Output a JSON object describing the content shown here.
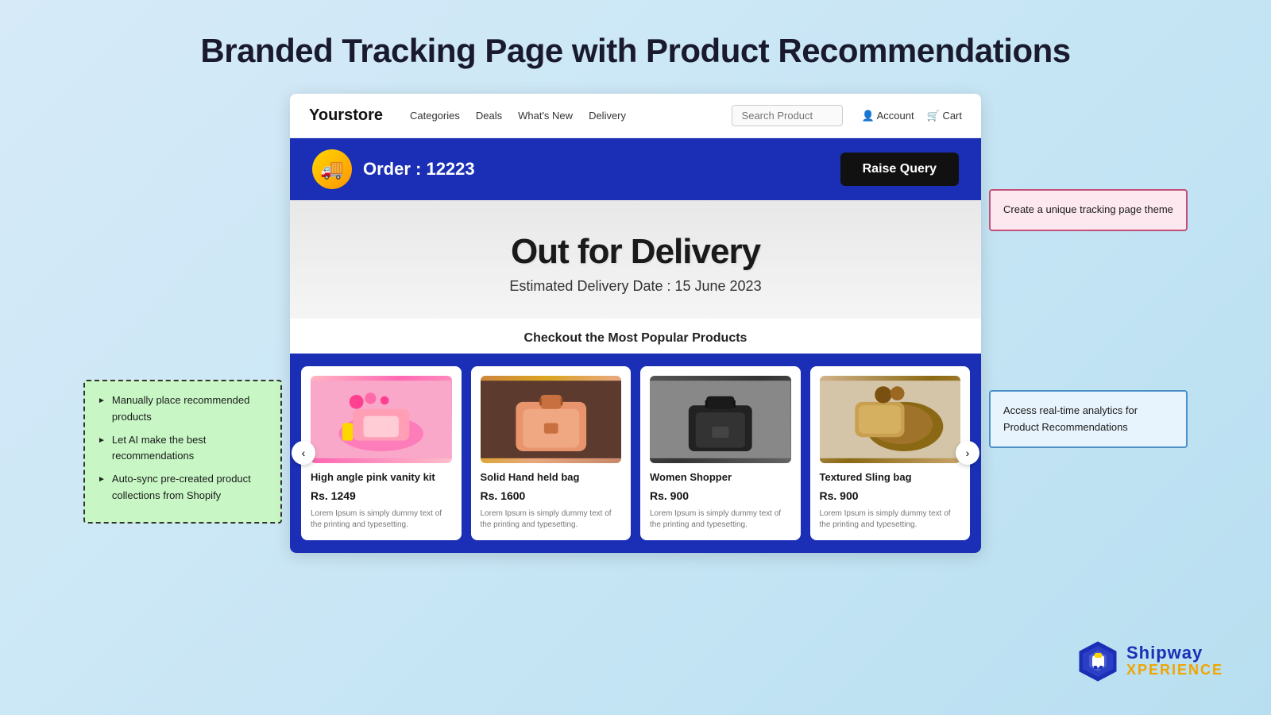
{
  "page": {
    "title": "Branded Tracking Page with Product Recommendations"
  },
  "store": {
    "logo": "Yourstore",
    "nav": {
      "links": [
        "Categories",
        "Deals",
        "What's New",
        "Delivery"
      ],
      "search_placeholder": "Search Product",
      "account_label": "Account",
      "cart_label": "Cart"
    }
  },
  "order_banner": {
    "order_label": "Order : 12223",
    "raise_query_btn": "Raise Query",
    "icon": "🚚"
  },
  "delivery": {
    "status": "Out for Delivery",
    "estimated_label": "Estimated Delivery Date : 15 June 2023"
  },
  "popular_section": {
    "title": "Checkout the Most Popular Products"
  },
  "products": [
    {
      "name": "High angle pink vanity kit",
      "price": "Rs. 1249",
      "description": "Lorem Ipsum is simply dummy text of the printing and typesetting.",
      "img_type": "pink-vanity"
    },
    {
      "name": "Solid Hand held bag",
      "price": "Rs. 1600",
      "description": "Lorem Ipsum is simply dummy text of the printing and typesetting.",
      "img_type": "salmon-bag"
    },
    {
      "name": "Women Shopper",
      "price": "Rs. 900",
      "description": "Lorem Ipsum is simply dummy text of the printing and typesetting.",
      "img_type": "black-bag"
    },
    {
      "name": "Textured Sling bag",
      "price": "Rs. 900",
      "description": "Lorem Ipsum is simply dummy text of the printing and typesetting.",
      "img_type": "brown-sling"
    }
  ],
  "left_annotation": {
    "items": [
      "Manually place recommended products",
      "Let AI make the best recommendations",
      "Auto-sync pre-created product collections from Shopify"
    ]
  },
  "right_annotations": {
    "top": "Create a unique tracking page theme",
    "bottom": "Access real-time analytics for Product Recommendations"
  },
  "shipway": {
    "name": "Shipway",
    "sub": "XPERIENCE"
  }
}
